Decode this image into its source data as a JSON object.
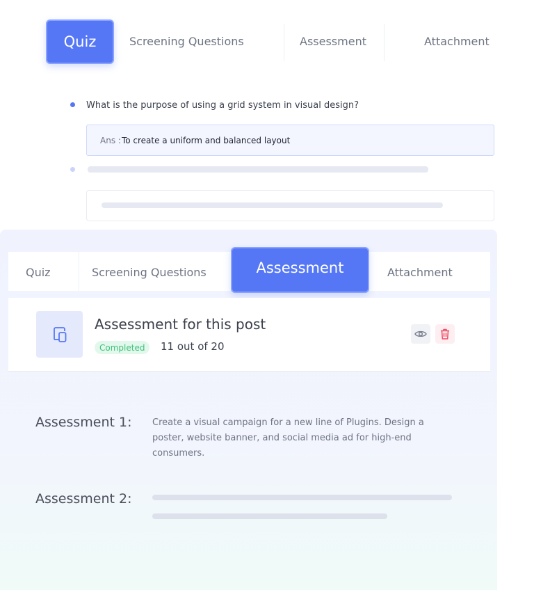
{
  "top_tabs": {
    "quiz": "Quiz",
    "screening": "Screening Questions",
    "assessment": "Assessment",
    "attachment": "Attachment"
  },
  "quiz": {
    "question": "What is the purpose of using a grid system in visual design?",
    "answer_label": "Ans :",
    "answer_value": "To create a uniform and balanced layout"
  },
  "panel_tabs": {
    "quiz": "Quiz",
    "screening": "Screening Questions",
    "assessment": "Assessment",
    "attachment": "Attachment"
  },
  "assessment_card": {
    "title": "Assessment for this post",
    "status": "Completed",
    "progress": "11 out of 20",
    "completed_count": 11,
    "total_count": 20
  },
  "assessments": [
    {
      "label": "Assessment 1:",
      "description": "Create a visual campaign for a new line of Plugins. Design a poster, website banner, and social media ad for high-end consumers."
    },
    {
      "label": "Assessment 2:",
      "description": ""
    }
  ],
  "colors": {
    "accent": "#5577f5",
    "status_green": "#3fc07a",
    "delete_red": "#ef4a63"
  },
  "icons": [
    "devices-icon",
    "eye-icon",
    "trash-icon"
  ]
}
